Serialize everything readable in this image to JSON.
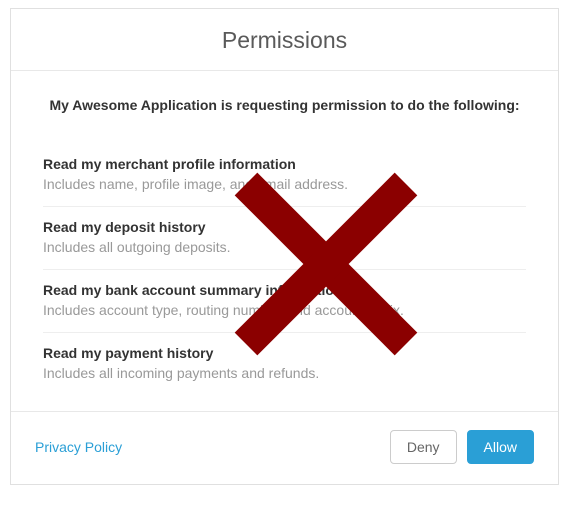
{
  "modal": {
    "title": "Permissions",
    "request": {
      "app_name": "My Awesome Application",
      "suffix": " is requesting permission to do the following:"
    },
    "permissions": [
      {
        "title": "Read my merchant profile information",
        "desc": "Includes name, profile image, and email address."
      },
      {
        "title": "Read my deposit history",
        "desc": "Includes all outgoing deposits."
      },
      {
        "title": "Read my bank account summary information",
        "desc": "Includes account type, routing number, and account suffix."
      },
      {
        "title": "Read my payment history",
        "desc": "Includes all incoming payments and refunds."
      }
    ],
    "footer": {
      "privacy_label": "Privacy Policy",
      "deny_label": "Deny",
      "allow_label": "Allow"
    }
  },
  "overlay": {
    "name": "red-x-overlay",
    "color": "#8b0000"
  }
}
